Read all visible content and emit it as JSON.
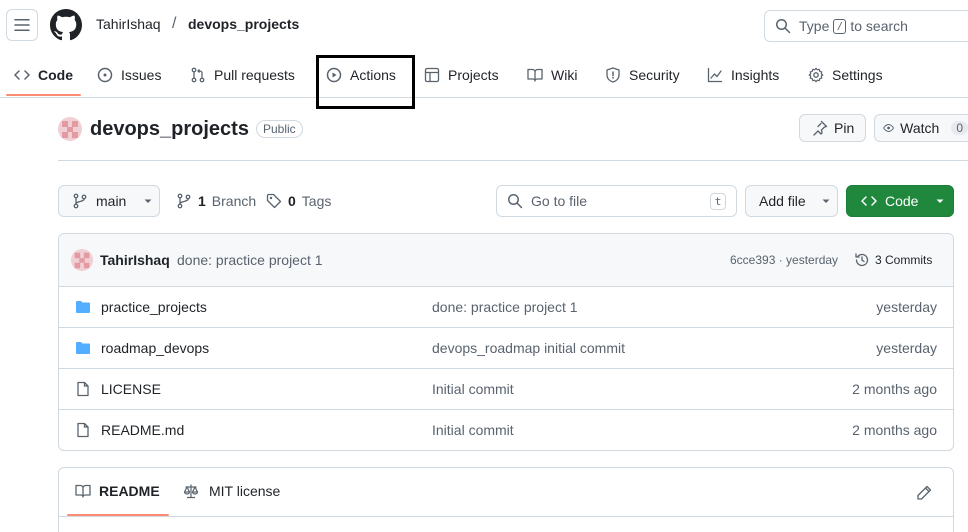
{
  "header": {
    "owner": "TahirIshaq",
    "separator": "/",
    "repo": "devops_projects",
    "search_prefix": "Type",
    "search_key": "/",
    "search_suffix": "to search"
  },
  "tabs": [
    {
      "label": "Code",
      "icon": "code-icon",
      "selected": true
    },
    {
      "label": "Issues",
      "icon": "issue-icon"
    },
    {
      "label": "Pull requests",
      "icon": "pull-request-icon"
    },
    {
      "label": "Actions",
      "icon": "play-icon"
    },
    {
      "label": "Projects",
      "icon": "table-icon"
    },
    {
      "label": "Wiki",
      "icon": "book-icon"
    },
    {
      "label": "Security",
      "icon": "shield-icon"
    },
    {
      "label": "Insights",
      "icon": "graph-icon"
    },
    {
      "label": "Settings",
      "icon": "gear-icon"
    }
  ],
  "repo_header": {
    "name": "devops_projects",
    "visibility": "Public",
    "pin_label": "Pin",
    "watch_label": "Watch",
    "watch_count": "0"
  },
  "toolbar": {
    "branch": "main",
    "branch_count": "1",
    "branch_label": "Branch",
    "tag_count": "0",
    "tag_label": "Tags",
    "goto_placeholder": "Go to file",
    "goto_key": "t",
    "add_file_label": "Add file",
    "code_label": "Code"
  },
  "commit": {
    "author": "TahirIshaq",
    "message": "done: practice project 1",
    "meta": "6cce393 · yesterday",
    "commits_label": "3 Commits"
  },
  "files": [
    {
      "type": "folder",
      "name": "practice_projects",
      "message": "done: practice project 1",
      "date": "yesterday"
    },
    {
      "type": "folder",
      "name": "roadmap_devops",
      "message": "devops_roadmap initial commit",
      "date": "yesterday"
    },
    {
      "type": "file",
      "name": "LICENSE",
      "message": "Initial commit",
      "date": "2 months ago"
    },
    {
      "type": "file",
      "name": "README.md",
      "message": "Initial commit",
      "date": "2 months ago"
    }
  ],
  "readme": {
    "tab_readme": "README",
    "tab_license": "MIT license"
  },
  "colors": {
    "accent_underline": "#fd8c73",
    "code_button": "#1f883d",
    "folder": "#54aeff"
  }
}
